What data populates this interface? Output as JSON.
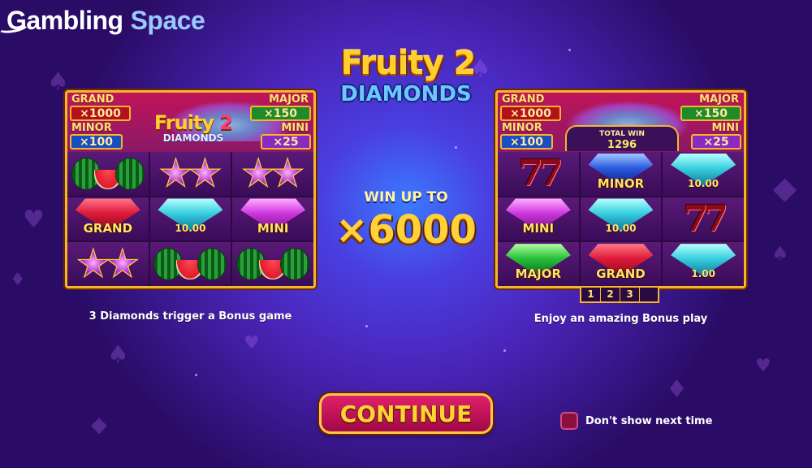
{
  "brand": {
    "part1": "Gambling",
    "part2": "Space"
  },
  "game_logo": {
    "title": "Fruity 2",
    "subtitle": "DIAMONDS"
  },
  "win": {
    "label": "WIN UP TO",
    "value": "×6000"
  },
  "jackpots": {
    "grand": {
      "label": "GRAND",
      "value": "×1000"
    },
    "major": {
      "label": "MAJOR",
      "value": "×150"
    },
    "minor": {
      "label": "MINOR",
      "value": "×100"
    },
    "mini": {
      "label": "MINI",
      "value": "×25"
    }
  },
  "left_panel": {
    "mini_logo": {
      "title": "Fruity",
      "number": "2",
      "subtitle": "DIAMONDS"
    },
    "cells": [
      {
        "symbol": "watermelon"
      },
      {
        "symbol": "stars"
      },
      {
        "symbol": "stars"
      },
      {
        "symbol": "red-gem",
        "label": "GRAND"
      },
      {
        "symbol": "cyan-gem",
        "value": "10.00"
      },
      {
        "symbol": "purple-gem",
        "label": "MINI"
      },
      {
        "symbol": "stars"
      },
      {
        "symbol": "watermelon"
      },
      {
        "symbol": "watermelon"
      }
    ],
    "caption": "3 Diamonds trigger a Bonus game"
  },
  "right_panel": {
    "total_win": {
      "label": "TOTAL WIN",
      "value": "1296"
    },
    "cells": [
      {
        "symbol": "seven"
      },
      {
        "symbol": "blue-gem",
        "label": "MINOR"
      },
      {
        "symbol": "cyan-gem",
        "value": "10.00"
      },
      {
        "symbol": "purple-gem",
        "label": "MINI"
      },
      {
        "symbol": "cyan-gem",
        "value": "10.00"
      },
      {
        "symbol": "seven"
      },
      {
        "symbol": "green-gem",
        "label": "MAJOR"
      },
      {
        "symbol": "red-gem",
        "label": "GRAND"
      },
      {
        "symbol": "cyan-gem",
        "value": "1.00"
      }
    ],
    "tabs": [
      "1",
      "2",
      "3"
    ],
    "caption": "Enjoy an amazing Bonus play"
  },
  "seven_glyph": "77",
  "continue_label": "CONTINUE",
  "dont_show_label": "Don't show next time",
  "colors": {
    "accent_gold": "#ffd23a",
    "button": "#c0145a",
    "background": "#4a24b8"
  }
}
